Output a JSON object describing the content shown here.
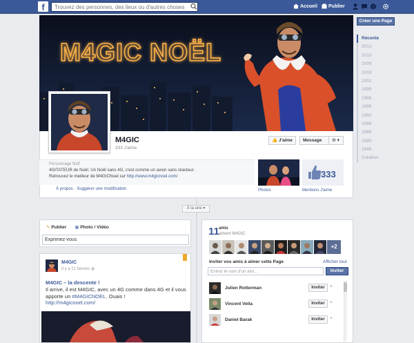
{
  "topbar": {
    "logo": "f",
    "search_placeholder": "Trouvez des personnes, des lieux ou d'autres choses",
    "home_label": "Accueil",
    "publish_label": "Publier"
  },
  "colors": {
    "brand": "#3b5998",
    "button_blue": "#5b74a8",
    "bookmark": "#f0a830"
  },
  "right_nav": {
    "create_page": "Créer une Page",
    "years": [
      "Récente",
      "2013",
      "2010",
      "2009",
      "2003",
      "2001",
      "1999",
      "1998",
      "1996",
      "1992",
      "1988",
      "1986",
      "1980",
      "1948",
      "Création"
    ],
    "active": "Récente"
  },
  "cover": {
    "title": "M4GIC NOËL"
  },
  "page": {
    "name": "M4GIC",
    "likes": "333 J'aime",
    "like_button": "J'aime",
    "message_button": "Message",
    "category": "Personnage fictif",
    "about_line1": "4GITATEUR de Noël. Un Noël sans 4G, c'est comme un avion sans réacteur.",
    "about_prefix": "Retrouvez le meilleur de M4GICNoel sur ",
    "about_link": "http://www.m4gicnoel.com/",
    "link_about": "À propos",
    "link_separator": " · ",
    "link_suggest": "Suggérer une modification"
  },
  "tiles": {
    "photos_label": "Photos",
    "likes_number": "333",
    "likes_label": "Mentions J'aime"
  },
  "timeline": {
    "filter_label": "À la une"
  },
  "composer": {
    "tab_publish": "Publier",
    "tab_photo": "Photo / Vidéo",
    "input_value": "Exprimez-vous"
  },
  "post": {
    "author": "M4GIC",
    "time": "Il y a 21 heures",
    "title": "M4GIC – la descente !",
    "body_prefix": "Il arrive, il est M4GIC, avec un 4G comme dans 4G et il vous apporte un ",
    "hashtag": "#M4GICNOEL",
    "body_suffix": ". Ouais !",
    "link": "http://m4gicnoel.com/"
  },
  "friends": {
    "count": "11",
    "amis": "amis",
    "aiment": "aiment M4GIC",
    "more": "+2",
    "invite_title": "Inviter vos amis à aimer cette Page",
    "show_all": "Afficher tout",
    "search_placeholder": "Entrez le nom d'un ami...",
    "invite_button": "Inviter",
    "invitees": [
      {
        "name": "Julien Rotterman",
        "button": "Inviter"
      },
      {
        "name": "Vincent Vella",
        "button": "Inviter"
      },
      {
        "name": "Daniel Barak",
        "button": "Inviter"
      }
    ],
    "remove": "×"
  }
}
